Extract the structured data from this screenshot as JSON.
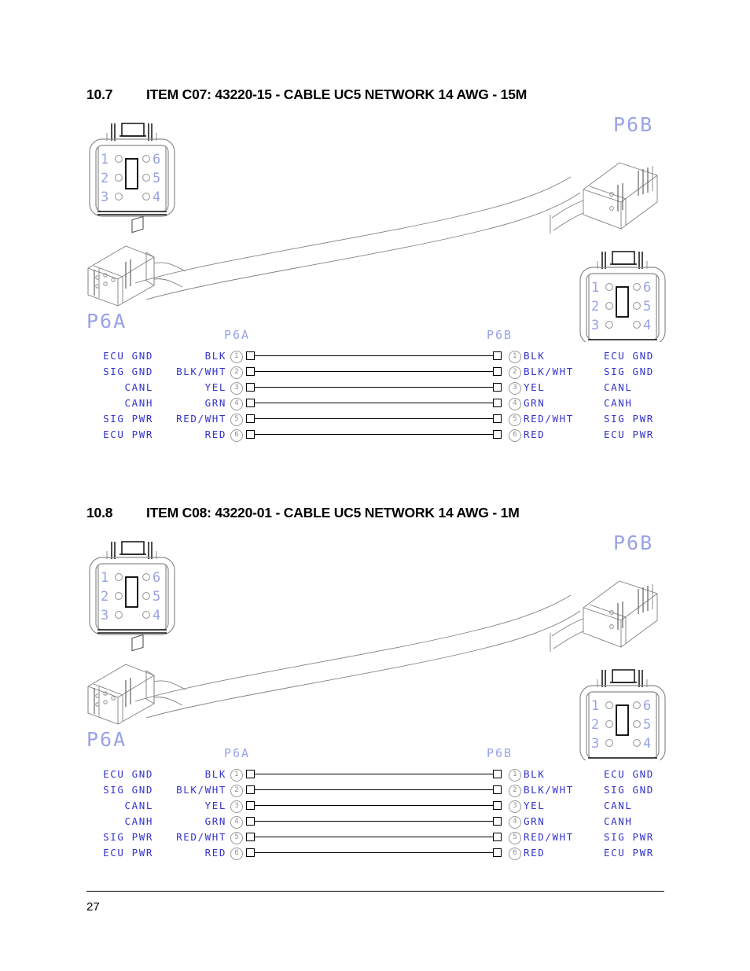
{
  "document": {
    "page_number": "27"
  },
  "sections": [
    {
      "number": "10.7",
      "title": "ITEM C07: 43220-15 - CABLE UC5 NETWORK 14 AWG - 15M",
      "connector_a_label": "P6A",
      "connector_b_label": "P6B",
      "face_pins_left": [
        "1",
        "2",
        "3"
      ],
      "face_pins_right": [
        "6",
        "5",
        "4"
      ],
      "table": {
        "header_left": "P6A",
        "header_right": "P6B",
        "rows": [
          {
            "pin": "1",
            "function_left": "ECU GND",
            "wire_left": "BLK",
            "wire_right": "BLK",
            "function_right": "ECU GND"
          },
          {
            "pin": "2",
            "function_left": "SIG GND",
            "wire_left": "BLK/WHT",
            "wire_right": "BLK/WHT",
            "function_right": "SIG GND"
          },
          {
            "pin": "3",
            "function_left": "CANL",
            "wire_left": "YEL",
            "wire_right": "YEL",
            "function_right": "CANL"
          },
          {
            "pin": "4",
            "function_left": "CANH",
            "wire_left": "GRN",
            "wire_right": "GRN",
            "function_right": "CANH"
          },
          {
            "pin": "5",
            "function_left": "SIG PWR",
            "wire_left": "RED/WHT",
            "wire_right": "RED/WHT",
            "function_right": "SIG PWR"
          },
          {
            "pin": "6",
            "function_left": "ECU PWR",
            "wire_left": "RED",
            "wire_right": "RED",
            "function_right": "ECU PWR"
          }
        ]
      }
    },
    {
      "number": "10.8",
      "title": "ITEM C08: 43220-01 - CABLE UC5 NETWORK 14 AWG - 1M",
      "connector_a_label": "P6A",
      "connector_b_label": "P6B",
      "face_pins_left": [
        "1",
        "2",
        "3"
      ],
      "face_pins_right": [
        "6",
        "5",
        "4"
      ],
      "table": {
        "header_left": "P6A",
        "header_right": "P6B",
        "rows": [
          {
            "pin": "1",
            "function_left": "ECU GND",
            "wire_left": "BLK",
            "wire_right": "BLK",
            "function_right": "ECU GND"
          },
          {
            "pin": "2",
            "function_left": "SIG GND",
            "wire_left": "BLK/WHT",
            "wire_right": "BLK/WHT",
            "function_right": "SIG GND"
          },
          {
            "pin": "3",
            "function_left": "CANL",
            "wire_left": "YEL",
            "wire_right": "YEL",
            "function_right": "CANL"
          },
          {
            "pin": "4",
            "function_left": "CANH",
            "wire_left": "GRN",
            "wire_right": "GRN",
            "function_right": "CANH"
          },
          {
            "pin": "5",
            "function_left": "SIG PWR",
            "wire_left": "RED/WHT",
            "wire_right": "RED/WHT",
            "function_right": "SIG PWR"
          },
          {
            "pin": "6",
            "function_left": "ECU PWR",
            "wire_left": "RED",
            "wire_right": "RED",
            "function_right": "ECU PWR"
          }
        ]
      }
    }
  ],
  "colors": {
    "label_blue": "#3333cc",
    "light_blue": "#9aa2e8",
    "line_gray": "#808080",
    "black": "#000000"
  }
}
